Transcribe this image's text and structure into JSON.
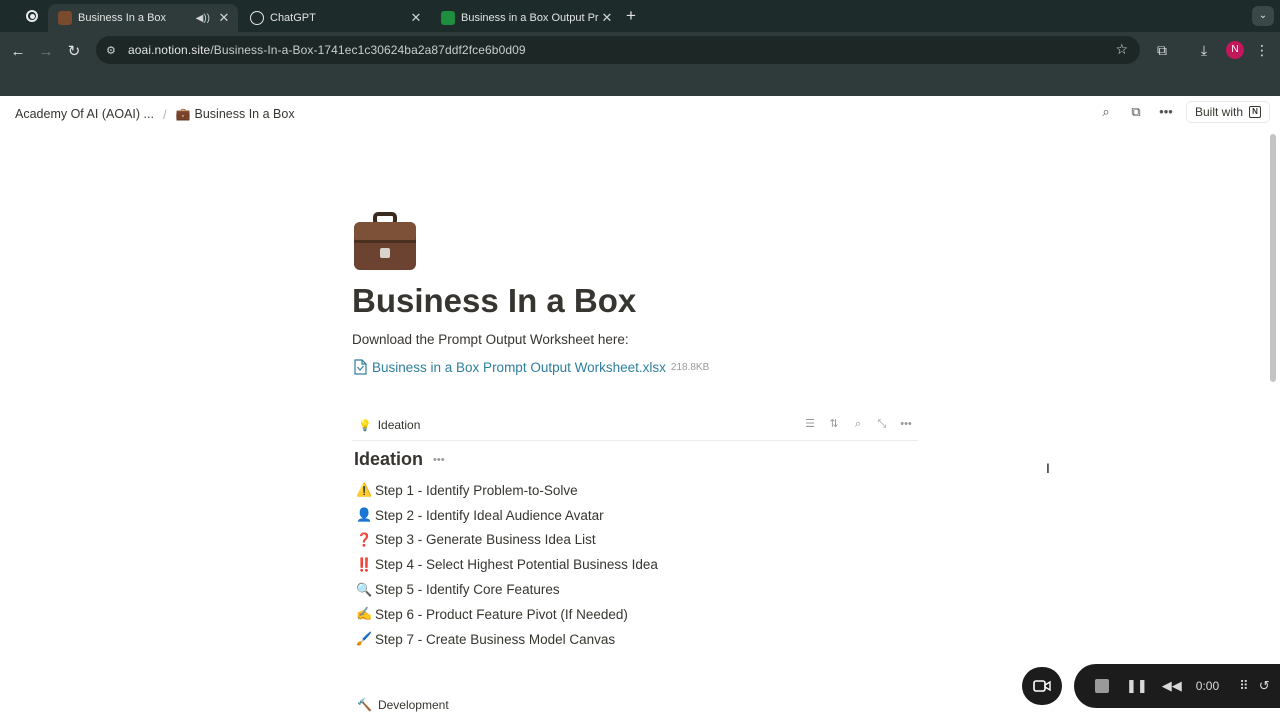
{
  "browser": {
    "tabs": [
      {
        "title": "Business In a Box",
        "active": true
      },
      {
        "title": "ChatGPT",
        "active": false
      },
      {
        "title": "Business in a Box Output Pro",
        "active": false
      }
    ],
    "url_host": "aoai.notion.site",
    "url_path": "/Business-In-a-Box-1741ec1c30624ba2a87ddf2fce6b0d09",
    "profile_initial": "N"
  },
  "notion": {
    "breadcrumb": [
      "Academy Of AI (AOAI) ...",
      "Business In a Box"
    ],
    "built_with": "Built with"
  },
  "page": {
    "title": "Business In a Box",
    "description": "Download the Prompt Output Worksheet here:",
    "file_name": "Business in a Box Prompt Output Worksheet.xlsx",
    "file_size": "218.8KB",
    "db_view": "Ideation",
    "section_title": "Ideation",
    "steps": [
      {
        "emoji": "⚠️",
        "label": "Step 1 - Identify Problem-to-Solve"
      },
      {
        "emoji": "👤",
        "label": "Step 2 - Identify Ideal Audience Avatar"
      },
      {
        "emoji": "❓",
        "label": "Step 3 - Generate Business Idea List"
      },
      {
        "emoji": "‼️",
        "label": "Step 4 - Select Highest Potential Business Idea"
      },
      {
        "emoji": "🔍",
        "label": "Step 5 - Identify Core Features"
      },
      {
        "emoji": "✍️",
        "label": "Step 6 - Product Feature Pivot (If Needed)"
      },
      {
        "emoji": "🖌️",
        "label": "Step 7 - Create Business Model Canvas"
      }
    ],
    "next_section": "Development"
  },
  "recorder": {
    "time": "0:00"
  }
}
